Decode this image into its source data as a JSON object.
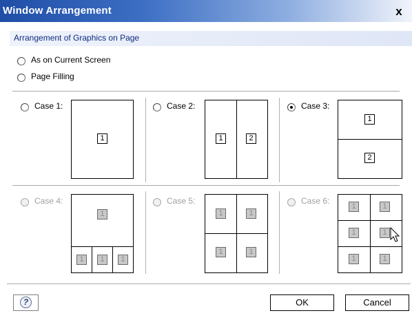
{
  "window": {
    "title": "Window Arrangement",
    "close_glyph": "x"
  },
  "group": {
    "label": "Arrangement of Graphics on Page"
  },
  "options": [
    {
      "label": "As on Current Screen",
      "checked": false
    },
    {
      "label": "Page Filling",
      "checked": false
    }
  ],
  "cases": [
    {
      "label": "Case 1:",
      "checked": false,
      "enabled": true,
      "numbers": [
        "1"
      ]
    },
    {
      "label": "Case 2:",
      "checked": false,
      "enabled": true,
      "numbers": [
        "1",
        "2"
      ]
    },
    {
      "label": "Case 3:",
      "checked": true,
      "enabled": true,
      "numbers": [
        "1",
        "2"
      ]
    },
    {
      "label": "Case 4:",
      "checked": false,
      "enabled": false,
      "numbers": [
        "1",
        "1",
        "1",
        "1"
      ]
    },
    {
      "label": "Case 5:",
      "checked": false,
      "enabled": false,
      "numbers": [
        "1",
        "1",
        "1",
        "1"
      ]
    },
    {
      "label": "Case 6:",
      "checked": false,
      "enabled": false,
      "numbers": [
        "1",
        "1",
        "1",
        "1",
        "1",
        "1"
      ]
    }
  ],
  "buttons": {
    "help_icon": "help-icon",
    "help_glyph": "?",
    "ok": "OK",
    "cancel": "Cancel"
  },
  "colors": {
    "title_bar": "#1f4ea6",
    "group_header_text": "#0f2a80",
    "disabled_text": "#a0a0a0"
  }
}
